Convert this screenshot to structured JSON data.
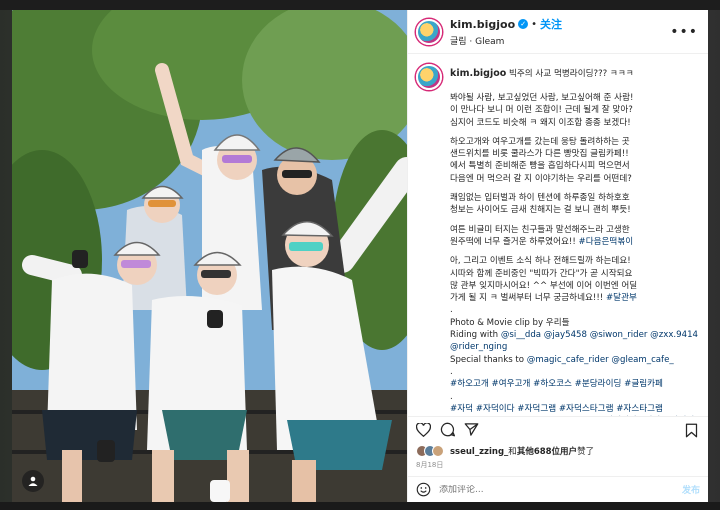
{
  "post": {
    "username": "kim.bigjoo",
    "follow_label": "关注",
    "subtitle": "글림 · Gleam",
    "more_label": "•••"
  },
  "caption": {
    "username": "kim.bigjoo",
    "title": "빅주의 사교 먹병라이딩??? ㅋㅋㅋ",
    "lines": [
      {
        "text": "봐야될 사람, 보고싶었던 사람, 보고싶어해 준 사람!",
        "style": ""
      },
      {
        "text": "이 만나다 보니 머 이런 조합이! 근데 될게 잘 맞아?",
        "style": ""
      },
      {
        "text": "심지어 코드도 비슷해 ㅋ 왜지 이조합 종종 보겠다!",
        "style": ""
      },
      {
        "text": "",
        "style": "blank"
      },
      {
        "text": "하오고개와 여우고개를 갔는데 웅탕 돌려하하는 곳",
        "style": ""
      },
      {
        "text": "샌드위치를 비롯 쿨라스가 다른 빵맛집 글림카페!!",
        "style": ""
      },
      {
        "text": "에서 특별히 준비해준 빵을 흡입하다시피 먹으면서",
        "style": ""
      },
      {
        "text": "다음엔 머 먹으러 갈 지 이야기하는 우리를 어떤데?",
        "style": ""
      },
      {
        "text": "",
        "style": "blank"
      },
      {
        "text": "쾌임없는 입터벌과 하이 텐션에 하루종일 하하호호",
        "style": ""
      },
      {
        "text": "청보는 사이어도 금새 친해지는 걸 보니 괜히 뿌듯!",
        "style": ""
      },
      {
        "text": "",
        "style": "blank"
      },
      {
        "text": "여튼 비글미 터지는 친구들과 말선해주느라 고생한",
        "style": ""
      },
      {
        "text": "원주떡에 너무 즐거운 하루였어요!! #다음은떡볶이",
        "style": "mixed1"
      },
      {
        "text": "",
        "style": "blank"
      },
      {
        "text": "아, 그리고 이벤트 소식 하나 전해드릴까 하는데요!",
        "style": ""
      },
      {
        "text": "시따와 함께 준비중인 \"빅따가 간다\"가 곧 시작되요",
        "style": ""
      },
      {
        "text": "많 관부 잊지마시어요! ^^ 부선에 이어 이번엔 어딜",
        "style": ""
      },
      {
        "text": "가게 될 지 ㅋ 벌써부터 너무 궁금하네요!!! #달관부",
        "style": "mixed2"
      },
      {
        "text": ".",
        "style": ""
      },
      {
        "text": "Photo & Movie clip by 우리들",
        "style": ""
      },
      {
        "text": "Riding with @si__dda @jay5458 @siwon_rider @zxx.9414",
        "style": "mixed3"
      },
      {
        "text": "@rider_nging",
        "style": "blue"
      },
      {
        "text": "Special thanks to @magic_cafe_rider @gleam_cafe_",
        "style": "mixed4"
      },
      {
        "text": ".",
        "style": ""
      },
      {
        "text": "#하오고개 #여우고개 #하오코스 #분당라이딩 #글림카페",
        "style": "blue"
      },
      {
        "text": ".",
        "style": ""
      },
      {
        "text": "#자덕 #자덕이다 #자덕그램 #자덕스타그램 #자스타그램",
        "style": "blue"
      },
      {
        "text": "#cyclinglife #cycling #cyclegram #자전거타는남자 #자전거타는",
        "style": "blue"
      }
    ],
    "mixed1_plain": "원주떡에 너무 즐거운 하루였어요!! ",
    "mixed1_tag": "#다음은떡볶이",
    "mixed2_plain": "가게 될 지 ㅋ 벌써부터 너무 궁금하네요!!! ",
    "mixed2_tag": "#달관부",
    "mixed3_plain": "Riding with ",
    "mixed3_tags": "@si__dda @jay5458 @siwon_rider @zxx.9414",
    "mixed4_plain": "Special thanks to ",
    "mixed4_tags": "@magic_cafe_rider @gleam_cafe_"
  },
  "likes": {
    "name": "sseul_zzing_",
    "rest_prefix": "和",
    "count_text": "其他688位用户",
    "suffix": "赞了"
  },
  "date": "8月18日",
  "comment": {
    "placeholder": "添加评论...",
    "post_label": "发布"
  },
  "colors": {
    "accent": "#0095f6",
    "hashtag": "#00376b"
  },
  "icons": [
    "heart-icon",
    "comment-icon",
    "share-icon",
    "bookmark-icon",
    "emoji-icon",
    "user-tag-icon",
    "verified-icon"
  ]
}
